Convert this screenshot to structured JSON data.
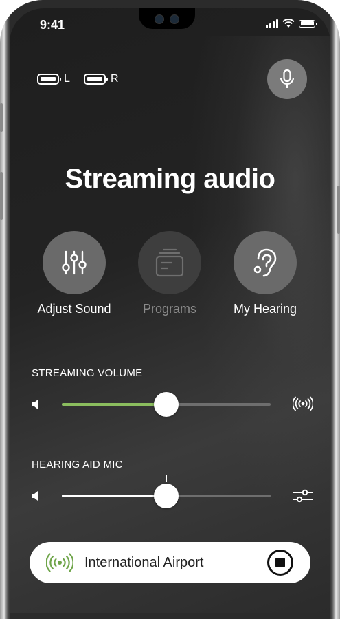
{
  "status_bar": {
    "time": "9:41",
    "icons": [
      "cellular-signal-icon",
      "wifi-icon",
      "battery-icon"
    ]
  },
  "hearing_aids": {
    "left": {
      "label": "L",
      "battery_level": 1.0
    },
    "right": {
      "label": "R",
      "battery_level": 1.0
    }
  },
  "mic_button": {
    "icon": "microphone-icon"
  },
  "header": {
    "title": "Streaming audio"
  },
  "actions": [
    {
      "label": "Adjust Sound",
      "icon": "equalizer-sliders-icon",
      "enabled": true
    },
    {
      "label": "Programs",
      "icon": "programs-card-icon",
      "enabled": false
    },
    {
      "label": "My Hearing",
      "icon": "ear-icon",
      "enabled": true
    }
  ],
  "streaming_volume": {
    "label": "STREAMING VOLUME",
    "value": 0.5,
    "left_icon": "speaker-low-icon",
    "right_icon": "broadcast-icon"
  },
  "hearing_aid_mic": {
    "label": "HEARING AID MIC",
    "value": 0.5,
    "default_marker": 0.5,
    "left_icon": "speaker-low-icon",
    "right_icon": "settings-sliders-icon"
  },
  "now_playing": {
    "name": "International Airport",
    "icon": "broadcast-icon",
    "control_icon": "stop-icon"
  },
  "colors": {
    "accent_green": "#8bbd5e",
    "background": "#232323",
    "button_gray": "#6a6a6a"
  }
}
